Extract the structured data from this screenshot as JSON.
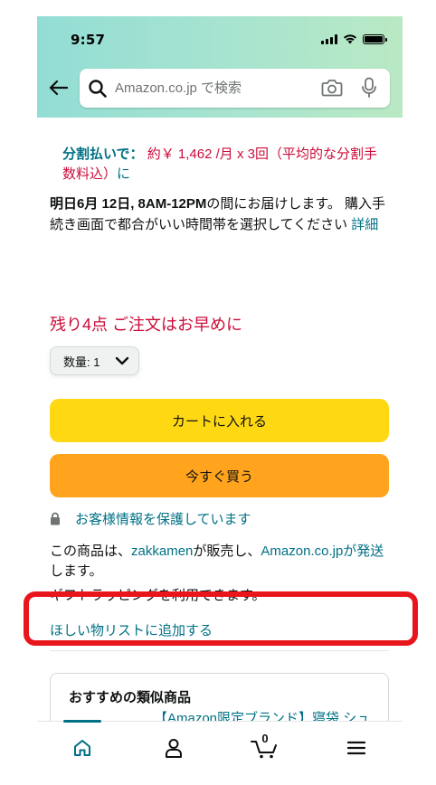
{
  "status_bar": {
    "time": "9:57",
    "icons": [
      "signal-icon",
      "wifi-icon",
      "battery-icon"
    ]
  },
  "header": {
    "search_placeholder": "Amazon.co.jp で検索",
    "icons": [
      "back-arrow-icon",
      "search-icon",
      "camera-icon",
      "microphone-icon"
    ]
  },
  "installment": {
    "label": "分割払いで：",
    "text": "約￥ 1,462 /月 x 3回（平均的な分割手数料込）",
    "link": "に"
  },
  "delivery": {
    "bold": "明日6月 12日, 8AM-12PM",
    "text": "の間にお届けします。 購入手続き画面で都合がいい時間帯を選択してください",
    "link": "詳細"
  },
  "stock_message": "残り4点 ご注文はお早めに",
  "quantity": {
    "label": "数量: 1"
  },
  "buttons": {
    "add_to_cart": "カートに入れる",
    "buy_now": "今すぐ買う"
  },
  "secure_transaction": "お客様情報を保護しています",
  "seller": {
    "prefix": "この商品は、",
    "seller_name": "zakkamen",
    "middle": "が販売し、",
    "shipper": "Amazon.co.jpが発送",
    "suffix": "します。"
  },
  "gift_wrap": "ギフトラッピングを利用できます。",
  "wishlist_link": "ほしい物リストに追加する",
  "recommendations": {
    "title": "おすすめの類似商品",
    "item_title": "【Amazon限定ブランド】寝袋 シュラフ 封筒型 保温 軽量"
  },
  "tab_bar": {
    "cart_count": "0",
    "tabs": [
      "home-icon",
      "account-icon",
      "cart-icon",
      "menu-icon"
    ]
  },
  "colors": {
    "link": "#007185",
    "alert": "#cc0c39",
    "cart_button": "#ffd814",
    "buy_button": "#ffa41c",
    "highlight_box": "#e8161c"
  }
}
